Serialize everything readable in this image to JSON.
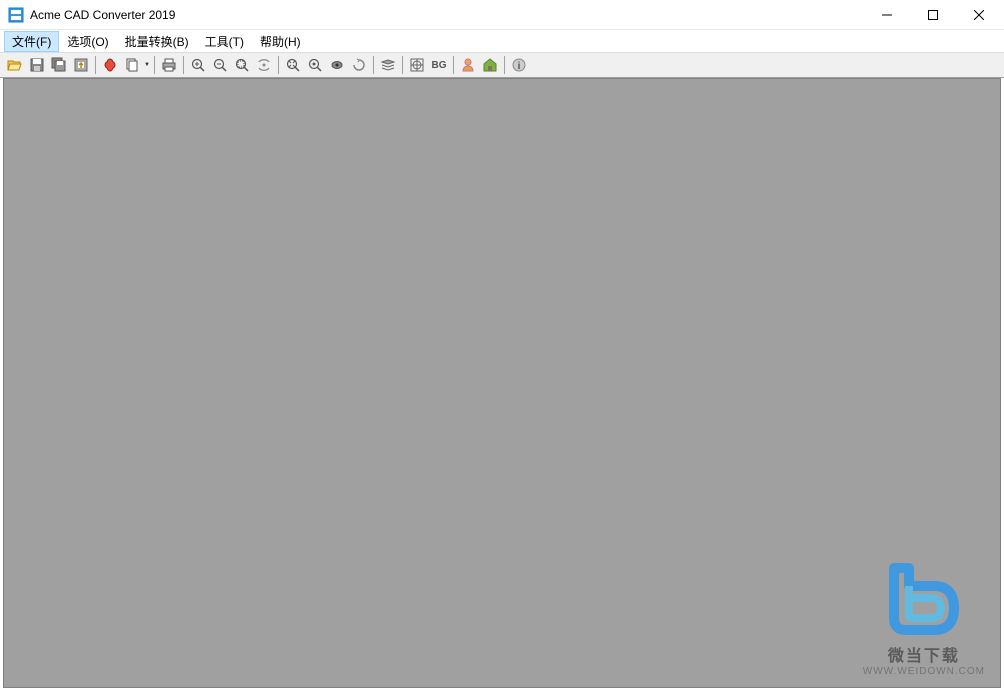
{
  "title": "Acme CAD Converter 2019",
  "menu": {
    "file": "文件(F)",
    "options": "选项(O)",
    "batch": "批量转换(B)",
    "tools": "工具(T)",
    "help": "帮助(H)"
  },
  "toolbar": {
    "open": "open",
    "save": "save",
    "save_all": "save-all",
    "convert": "convert",
    "pdf": "pdf-export",
    "copy": "copy",
    "print": "print",
    "zoom_in": "zoom-in",
    "zoom_out": "zoom-out",
    "zoom_window": "zoom-window",
    "zoom_dynamic": "zoom-dynamic",
    "zoom_extents": "zoom-extents",
    "zoom_realtime": "zoom-realtime",
    "pan": "pan",
    "rotate": "rotate",
    "layers": "layers",
    "measure": "measure",
    "bg": "BG",
    "user": "user",
    "home": "home",
    "info": "info"
  },
  "watermark": {
    "text": "微当下载",
    "url": "WWW.WEIDOWN.COM"
  }
}
